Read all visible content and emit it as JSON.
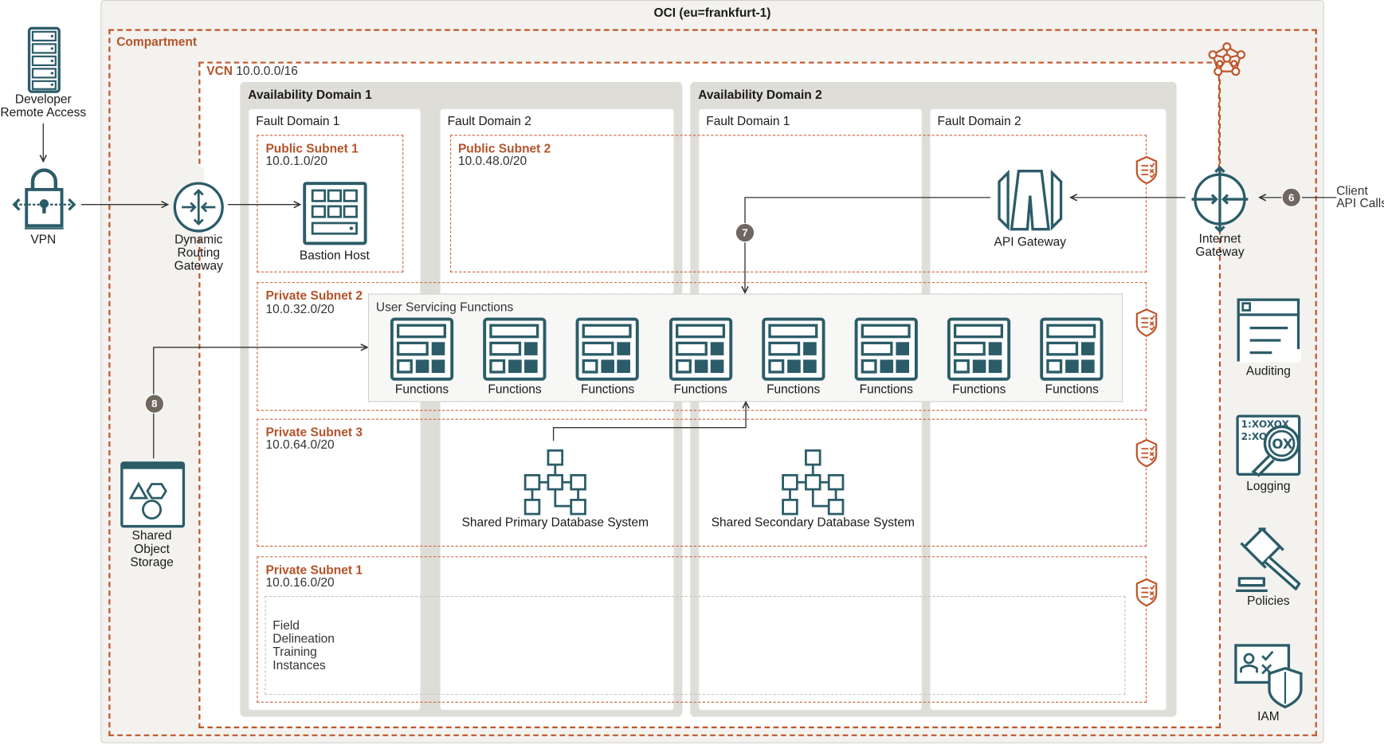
{
  "title": "OCI (eu=frankfurt-1)",
  "compartment": "Compartment",
  "vcn": {
    "label": "VCN",
    "cidr": "10.0.0.0/16"
  },
  "availability_domains": [
    {
      "label": "Availability Domain 1",
      "fault_domains": [
        "Fault Domain 1",
        "Fault Domain 2"
      ]
    },
    {
      "label": "Availability Domain 2",
      "fault_domains": [
        "Fault Domain 1",
        "Fault Domain 2"
      ]
    }
  ],
  "subnets": {
    "public1": {
      "name": "Public Subnet 1",
      "cidr": "10.0.1.0/20"
    },
    "public2": {
      "name": "Public Subnet 2",
      "cidr": "10.0.48.0/20"
    },
    "private2": {
      "name": "Private Subnet 2",
      "cidr": "10.0.32.0/20"
    },
    "private3": {
      "name": "Private Subnet 3",
      "cidr": "10.0.64.0/20"
    },
    "private1": {
      "name": "Private Subnet 1",
      "cidr": "10.0.16.0/20"
    }
  },
  "external": {
    "developer": [
      "Developer",
      "Remote Access"
    ],
    "vpn": "VPN",
    "drg": [
      "Dynamic",
      "Routing",
      "Gateway"
    ],
    "client": [
      "Client",
      "API Calls"
    ],
    "internet_gateway": [
      "Internet",
      "Gateway"
    ],
    "object_storage": [
      "Shared",
      "Object",
      "Storage"
    ]
  },
  "components": {
    "bastion": "Bastion Host",
    "api_gateway": "API Gateway",
    "functions_group": "User Servicing Functions",
    "functions": [
      "Functions",
      "Functions",
      "Functions",
      "Functions",
      "Functions",
      "Functions",
      "Functions",
      "Functions"
    ],
    "primary_db": "Shared Primary Database System",
    "secondary_db": "Shared Secondary Database System",
    "training_group": [
      "Field",
      "Delineation",
      "Training",
      "Instances"
    ]
  },
  "services": [
    "Auditing",
    "Logging",
    "Policies",
    "IAM"
  ],
  "logging_icon_text": [
    "1:XOXOX",
    "2:XO",
    "OX"
  ],
  "badges": {
    "six": "6",
    "seven": "7",
    "eight": "8"
  },
  "colors": {
    "teal": "#2b5c68",
    "rust": "#c0552a",
    "badge": "#6f6760"
  }
}
